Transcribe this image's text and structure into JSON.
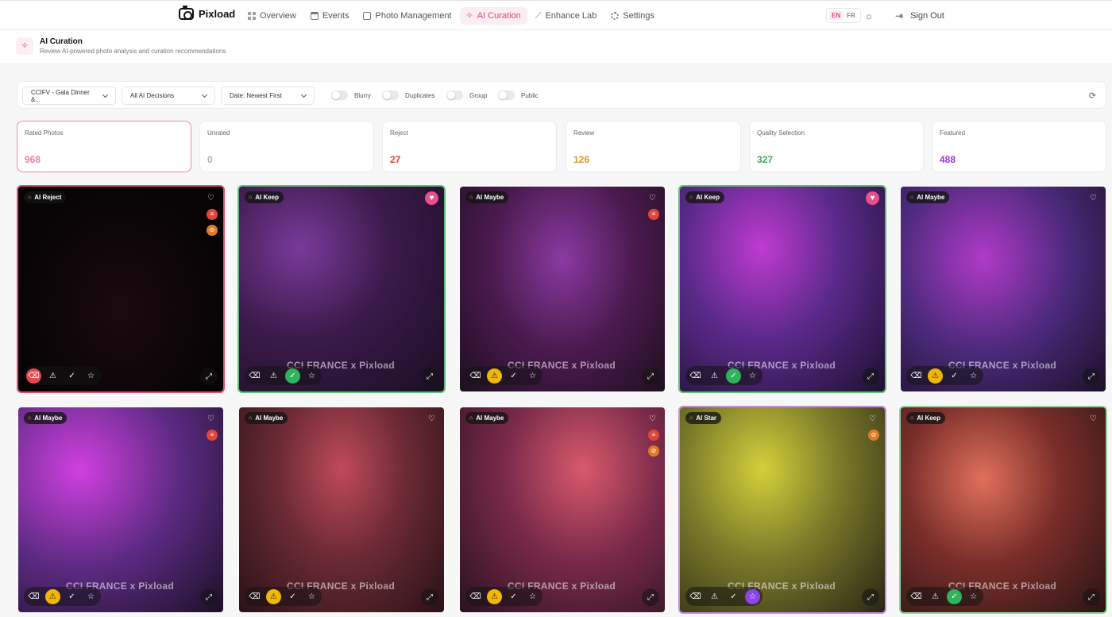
{
  "brand": {
    "name": "Pixload"
  },
  "nav": {
    "items": [
      {
        "label": "Overview",
        "icon": "grid-icon"
      },
      {
        "label": "Events",
        "icon": "calendar-icon"
      },
      {
        "label": "Photo Management",
        "icon": "image-icon"
      },
      {
        "label": "AI Curation",
        "icon": "sparkles-icon",
        "active": true
      },
      {
        "label": "Enhance Lab",
        "icon": "wand-icon"
      },
      {
        "label": "Settings",
        "icon": "gear-icon"
      }
    ],
    "lang_en": "EN",
    "lang_fr": "FR",
    "sign_out": "Sign Out"
  },
  "page": {
    "title": "AI Curation",
    "subtitle": "Review AI-powered photo analysis and curation recommendations"
  },
  "filters": {
    "event": "CCIFV - Gala Dinner &...",
    "decision": "All AI Decisions",
    "sort": "Date: Newest First",
    "toggles": [
      "Blurry",
      "Duplicates",
      "Group",
      "Public"
    ]
  },
  "stats": [
    {
      "label": "Rated Photos",
      "value": "968",
      "color": "#ea7fa2"
    },
    {
      "label": "Unrated",
      "value": "0",
      "color": "#b0b0b5"
    },
    {
      "label": "Reject",
      "value": "27",
      "color": "#d9443a"
    },
    {
      "label": "Review",
      "value": "126",
      "color": "#e0962c"
    },
    {
      "label": "Quality Selection",
      "value": "327",
      "color": "#3ea65b"
    },
    {
      "label": "Featured",
      "value": "488",
      "color": "#9b38e0"
    }
  ],
  "watermark": "CCI FRANCE  x  Pixload",
  "photos": [
    {
      "badge": "AI Reject",
      "heart": "empty",
      "decision": "reject",
      "flags": [
        "red",
        "orange"
      ],
      "border": "#e05070",
      "bg": "dark"
    },
    {
      "badge": "AI Keep",
      "heart": "fav",
      "decision": "keep",
      "flags": [],
      "border": "#5fbf76",
      "bg": "purple"
    },
    {
      "badge": "AI Maybe",
      "heart": "empty",
      "decision": "maybe",
      "flags": [
        "red"
      ],
      "border": "transparent",
      "bg": "purple2"
    },
    {
      "badge": "AI Keep",
      "heart": "fav",
      "decision": "keep",
      "flags": [],
      "border": "#5fbf76",
      "bg": "magenta"
    },
    {
      "badge": "AI Maybe",
      "heart": "empty",
      "decision": "maybe",
      "flags": [],
      "border": "transparent",
      "bg": "magenta2"
    },
    {
      "badge": "AI Maybe",
      "heart": "empty",
      "decision": "maybe",
      "flags": [
        "red"
      ],
      "border": "transparent",
      "bg": "magenta3"
    },
    {
      "badge": "AI Maybe",
      "heart": "empty",
      "decision": "maybe",
      "flags": [],
      "border": "transparent",
      "bg": "redroom"
    },
    {
      "badge": "AI Maybe",
      "heart": "empty",
      "decision": "maybe",
      "flags": [
        "red",
        "orange"
      ],
      "border": "transparent",
      "bg": "redroom2"
    },
    {
      "badge": "AI Star",
      "heart": "empty",
      "decision": "star",
      "flags": [
        "orange"
      ],
      "border": "#c58ae8",
      "bg": "yellow"
    },
    {
      "badge": "AI Keep",
      "heart": "empty",
      "decision": "keep",
      "flags": [],
      "border": "#8fd49e",
      "bg": "redroom3"
    }
  ]
}
